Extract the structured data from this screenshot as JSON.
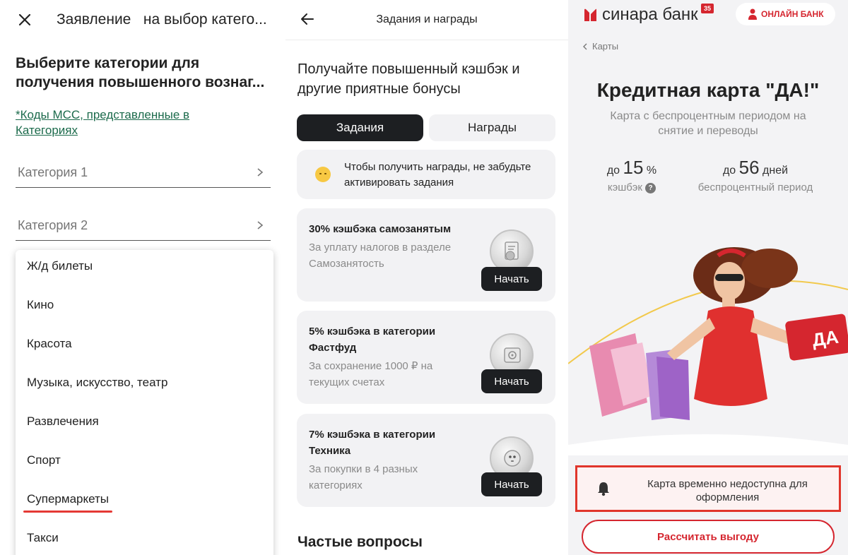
{
  "application_form": {
    "title": "Заявление   на выбор катего...",
    "heading": "Выберите категории для получения повышенного вознаг...",
    "mcc_link": "*Коды МСС, представленные в Категориях",
    "fields": [
      {
        "label": "Категория 1"
      },
      {
        "label": "Категория 2"
      }
    ],
    "dropdown_options": [
      "Ж/д билеты",
      "Кино",
      "Красота",
      "Музыка, искусство, театр",
      "Развлечения",
      "Спорт",
      "Супермаркеты",
      "Такси"
    ],
    "highlighted_option": "Супермаркеты",
    "highlight_color": "#e53935"
  },
  "tasks_rewards": {
    "title": "Задания и награды",
    "heading": "Получайте повышенный кэшбэк и другие приятные бонусы",
    "tabs": [
      {
        "label": "Задания",
        "active": true
      },
      {
        "label": "Награды",
        "active": false
      }
    ],
    "notice": "Чтобы получить награды, не забудьте активировать задания",
    "cards": [
      {
        "title": "30% кэшбэка самозанятым",
        "description": "За уплату налогов в разделе Самозанятость",
        "button": "Начать",
        "icon": "document-ruble-icon"
      },
      {
        "title": "5% кэшбэка в категории Фастфуд",
        "description": "За сохранение 1000 ₽ на текущих счетах",
        "button": "Начать",
        "icon": "safe-icon"
      },
      {
        "title": "7% кэшбэка в категории Техника",
        "description": "За покупки в 4 разных категориях",
        "button": "Начать",
        "icon": "robot-vacuum-icon"
      }
    ],
    "faq_heading": "Частые вопросы",
    "colors": {
      "dark": "#1d1f22",
      "card": "#f2f2f4"
    }
  },
  "bank_page": {
    "logo_text": "синара банк",
    "logo_badge": "35",
    "online_bank": "ОНЛАЙН БАНК",
    "breadcrumb": "Карты",
    "title": "Кредитная карта \"ДА!\"",
    "subtitle": "Карта с беспроцентным периодом на снятие и переводы",
    "stats": [
      {
        "prefix": "до",
        "value": "15",
        "unit": "%",
        "caption": "кэшбэк"
      },
      {
        "prefix": "до",
        "value": "56",
        "unit": "дней",
        "caption": "беспроцентный период"
      }
    ],
    "help_mark": "?",
    "card_text": "ДА",
    "alert": "Карта временно недоступна для оформления",
    "calc_button": "Рассчитать выгоду",
    "colors": {
      "brand": "#d5262f",
      "alert_border": "#e0362c",
      "dress": "#e0302f"
    }
  }
}
